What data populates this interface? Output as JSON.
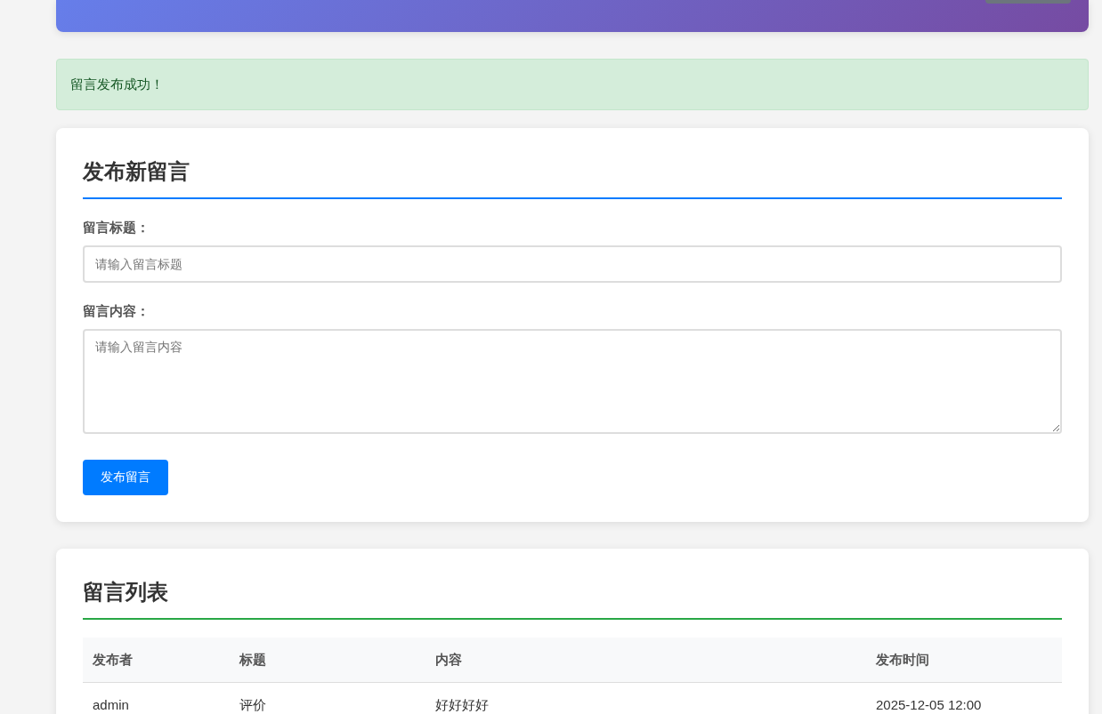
{
  "alert": {
    "kind": "success",
    "text": "留言发布成功！"
  },
  "post_form": {
    "title": "发布新留言",
    "fields": [
      {
        "kind": "input",
        "label": "留言标题：",
        "placeholder": "请输入留言标题"
      },
      {
        "kind": "textarea",
        "label": "留言内容：",
        "placeholder": "请输入留言内容"
      }
    ],
    "submit_button": "发布留言"
  },
  "message_list": {
    "title": "留言列表",
    "table": {
      "columns": [
        "发布者",
        "标题",
        "内容",
        "发布时间"
      ],
      "rows": [
        [
          "admin",
          "评价",
          "好好好好",
          "2025-12-05 12:00"
        ]
      ]
    }
  }
}
